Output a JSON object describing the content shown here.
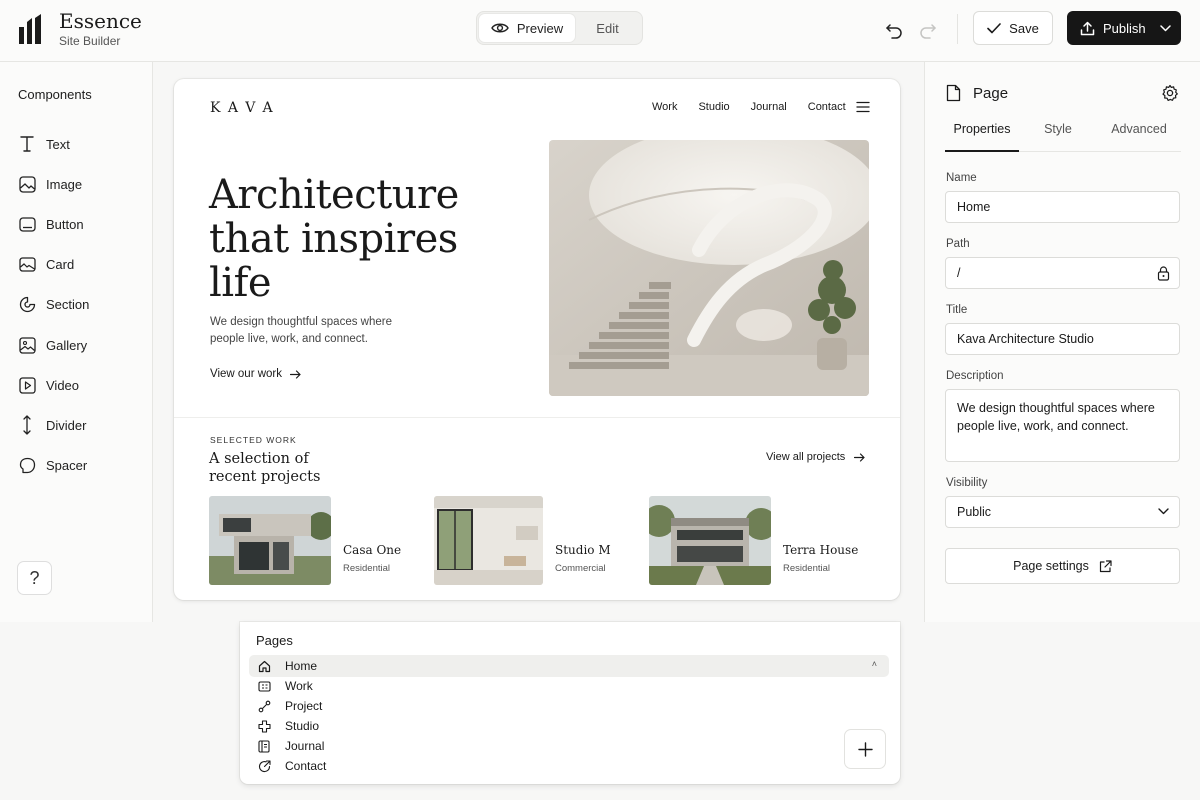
{
  "app": {
    "name": "Essence",
    "subtitle": "Site Builder"
  },
  "toolbar": {
    "preview_label": "Preview",
    "edit_label": "Edit",
    "save_label": "Save",
    "publish_label": "Publish",
    "active_mode": "Preview"
  },
  "components": {
    "title": "Components",
    "items": [
      {
        "label": "Text",
        "icon": "text-icon"
      },
      {
        "label": "Image",
        "icon": "image-icon"
      },
      {
        "label": "Button",
        "icon": "button-icon"
      },
      {
        "label": "Card",
        "icon": "card-icon"
      },
      {
        "label": "Section",
        "icon": "section-icon"
      },
      {
        "label": "Gallery",
        "icon": "gallery-icon"
      },
      {
        "label": "Video",
        "icon": "video-icon"
      },
      {
        "label": "Divider",
        "icon": "divider-icon"
      },
      {
        "label": "Spacer",
        "icon": "spacer-icon"
      }
    ],
    "help_label": "?"
  },
  "site": {
    "logo": "KAVA",
    "nav": [
      "Work",
      "Studio",
      "Journal",
      "Contact"
    ],
    "hero": {
      "title": "Architecture that inspires life",
      "description": "We design thoughtful spaces where people live, work, and connect.",
      "link": "View our work"
    },
    "selected": {
      "eyebrow": "SELECTED WORK",
      "title": "A selection of recent projects",
      "view_all": "View all projects"
    },
    "projects": [
      {
        "name": "Casa One",
        "category": "Residential"
      },
      {
        "name": "Studio M",
        "category": "Commercial"
      },
      {
        "name": "Terra House",
        "category": "Residential"
      }
    ]
  },
  "inspector": {
    "header": "Page",
    "tabs": [
      "Properties",
      "Style",
      "Advanced"
    ],
    "active_tab": "Properties",
    "fields": {
      "name_label": "Name",
      "name_value": "Home",
      "path_label": "Path",
      "path_value": "/",
      "title_label": "Title",
      "title_value": "Kava Architecture Studio",
      "description_label": "Description",
      "description_value": "We design thoughtful spaces where people live, work, and connect.",
      "visibility_label": "Visibility",
      "visibility_value": "Public"
    },
    "settings_button": "Page settings"
  },
  "pages": {
    "title": "Pages",
    "items": [
      {
        "label": "Home",
        "icon": "home-icon",
        "selected": true
      },
      {
        "label": "Work",
        "icon": "grid-icon",
        "selected": false
      },
      {
        "label": "Project",
        "icon": "link-icon",
        "selected": false
      },
      {
        "label": "Studio",
        "icon": "puzzle-icon",
        "selected": false
      },
      {
        "label": "Journal",
        "icon": "book-icon",
        "selected": false
      },
      {
        "label": "Contact",
        "icon": "contact-icon",
        "selected": false
      }
    ],
    "caret": "˄",
    "add_label": "+"
  },
  "colors": {
    "accent": "#161616",
    "background": "#f7f7f6",
    "panel": "#fbfbfa"
  }
}
